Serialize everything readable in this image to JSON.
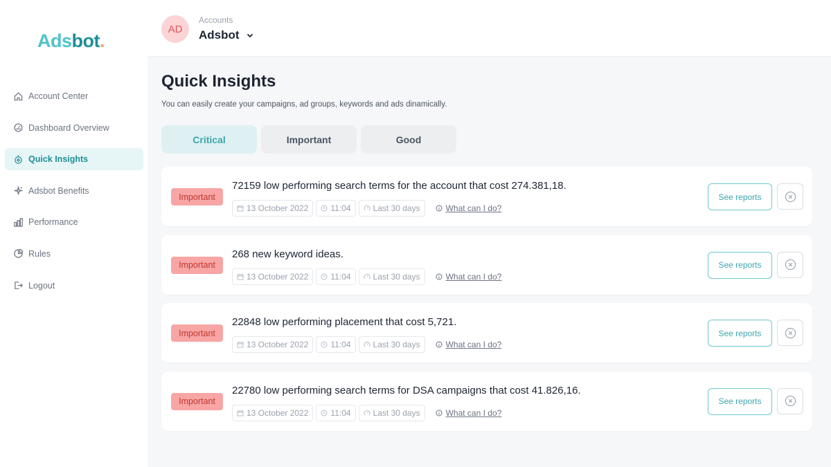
{
  "brand": {
    "logo_part1": "Ads",
    "logo_part2": "bot",
    "logo_dot": "."
  },
  "sidebar": {
    "items": [
      {
        "label": "Account Center",
        "icon": "home-icon",
        "active": false
      },
      {
        "label": "Dashboard Overview",
        "icon": "gauge-icon",
        "active": false
      },
      {
        "label": "Quick Insights",
        "icon": "insights-icon",
        "active": true
      },
      {
        "label": "Adsbot Benefits",
        "icon": "sparkle-icon",
        "active": false
      },
      {
        "label": "Performance",
        "icon": "bar-chart-icon",
        "active": false
      },
      {
        "label": "Rules",
        "icon": "pie-chart-icon",
        "active": false
      },
      {
        "label": "Logout",
        "icon": "logout-icon",
        "active": false
      }
    ]
  },
  "header": {
    "avatar_initials": "AD",
    "accounts_label": "Accounts",
    "account_name": "Adsbot"
  },
  "main": {
    "title": "Quick Insights",
    "subtitle": "You can easily create your campaigns, ad groups, keywords and ads dinamically.",
    "tabs": [
      {
        "label": "Critical",
        "active": true
      },
      {
        "label": "Important",
        "active": false
      },
      {
        "label": "Good",
        "active": false
      }
    ],
    "insights": [
      {
        "badge": "Important",
        "text": "72159 low performing search terms for the account that cost 274.381,18.",
        "date": "13 October 2022",
        "time": "11:04",
        "period": "Last 30 days",
        "help": "What can I do?",
        "action": "See reports"
      },
      {
        "badge": "Important",
        "text": "268 new keyword ideas.",
        "date": "13 October 2022",
        "time": "11:04",
        "period": "Last 30 days",
        "help": "What can I do?",
        "action": "See reports"
      },
      {
        "badge": "Important",
        "text": "22848 low performing placement that cost 5,721.",
        "date": "13 October 2022",
        "time": "11:04",
        "period": "Last 30 days",
        "help": "What can I do?",
        "action": "See reports"
      },
      {
        "badge": "Important",
        "text": "22780 low performing search terms for DSA campaigns that cost 41.826,16.",
        "date": "13 October 2022",
        "time": "11:04",
        "period": "Last 30 days",
        "help": "What can I do?",
        "action": "See reports"
      }
    ]
  },
  "colors": {
    "accent": "#3ba6ad",
    "accent_light": "#def0f2",
    "badge_bg": "#f8a5a5",
    "badge_text": "#c0392f",
    "avatar_bg": "#fcd4d6"
  }
}
